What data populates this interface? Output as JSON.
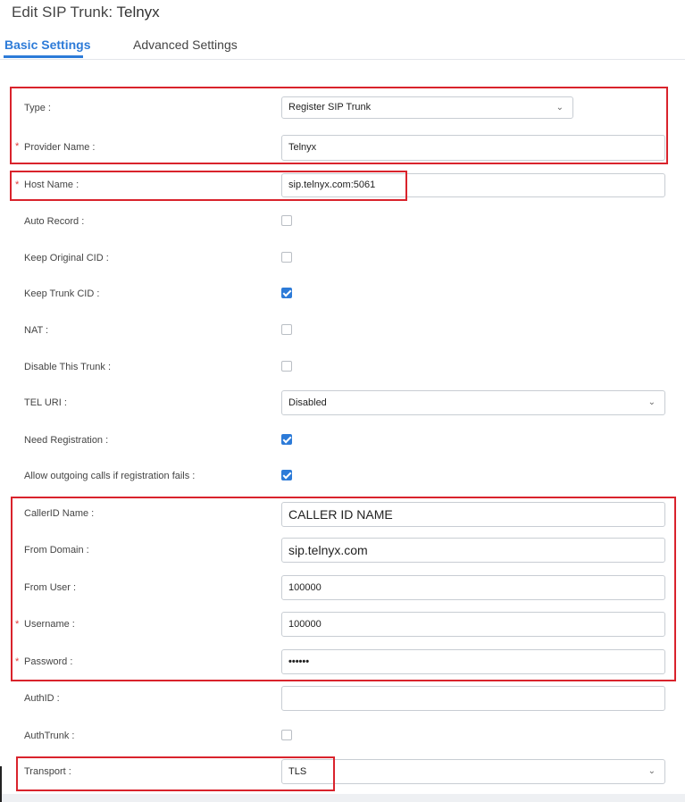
{
  "header": {
    "title_prefix": "Edit SIP Trunk:",
    "title_name": "Telnyx"
  },
  "tabs": [
    {
      "label": "Basic Settings",
      "active": true
    },
    {
      "label": "Advanced Settings",
      "active": false
    }
  ],
  "fields": {
    "type": {
      "label": "Type :",
      "value": "Register SIP Trunk"
    },
    "provider_name": {
      "label": "Provider Name :",
      "value": "Telnyx",
      "required": "*"
    },
    "host_name": {
      "label": "Host Name :",
      "value": "sip.telnyx.com:5061",
      "required": "*"
    },
    "auto_record": {
      "label": "Auto Record :",
      "checked": false
    },
    "keep_original_cid": {
      "label": "Keep Original CID :",
      "checked": false
    },
    "keep_trunk_cid": {
      "label": "Keep Trunk CID :",
      "checked": true
    },
    "nat": {
      "label": "NAT :",
      "checked": false
    },
    "disable_trunk": {
      "label": "Disable This Trunk :",
      "checked": false
    },
    "tel_uri": {
      "label": "TEL URI :",
      "value": "Disabled"
    },
    "need_registration": {
      "label": "Need Registration :",
      "checked": true
    },
    "allow_outgoing": {
      "label": "Allow outgoing calls if registration fails :",
      "checked": true
    },
    "callerid_name": {
      "label": "CallerID Name :",
      "value": "CALLER ID NAME"
    },
    "from_domain": {
      "label": "From Domain :",
      "value": "sip.telnyx.com"
    },
    "from_user": {
      "label": "From User :",
      "value": "100000"
    },
    "username": {
      "label": "Username :",
      "value": "100000",
      "required": "*"
    },
    "password": {
      "label": "Password :",
      "value": "••••••",
      "required": "*"
    },
    "authid": {
      "label": "AuthID :",
      "value": ""
    },
    "authtrunk": {
      "label": "AuthTrunk :",
      "checked": false
    },
    "transport": {
      "label": "Transport :",
      "value": "TLS"
    }
  },
  "colors": {
    "accent": "#2d7bd8",
    "highlight": "#d9232c",
    "required": "#e23b3b"
  }
}
